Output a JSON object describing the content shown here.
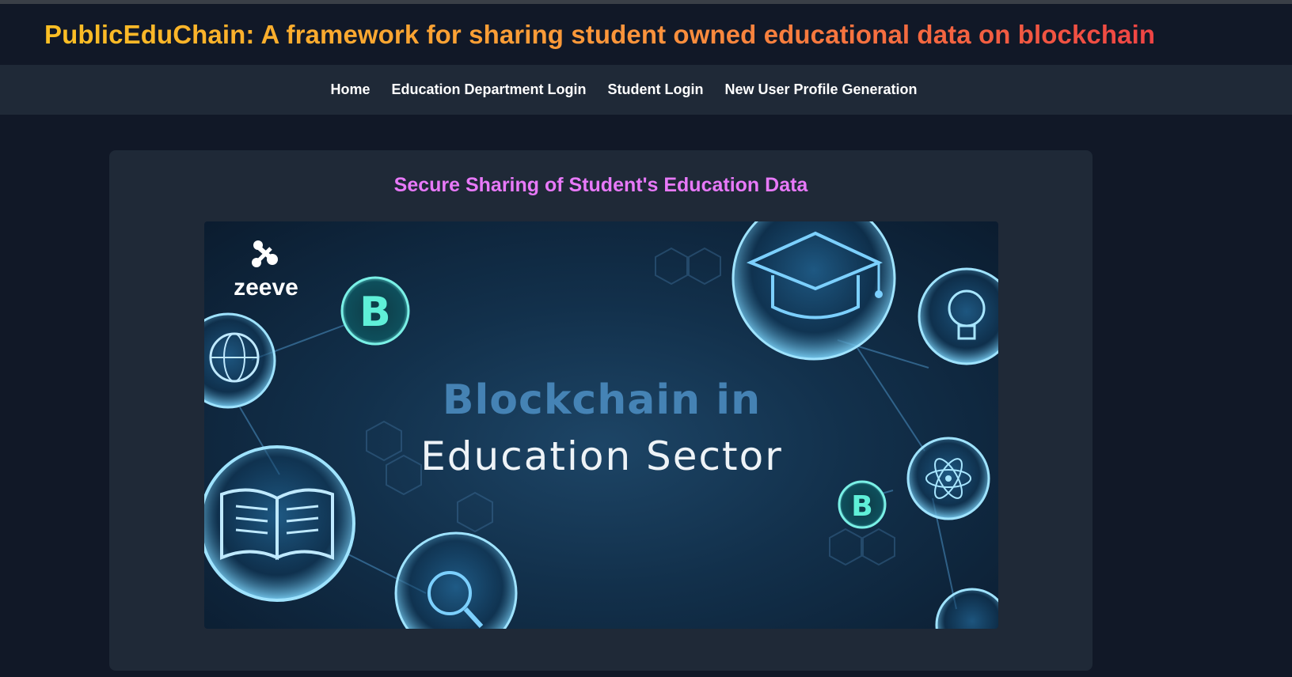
{
  "header": {
    "title": "PublicEduChain: A framework for sharing student owned educational data on blockchain"
  },
  "nav": {
    "items": [
      {
        "label": "Home"
      },
      {
        "label": "Education Department Login"
      },
      {
        "label": "Student Login"
      },
      {
        "label": "New User Profile Generation"
      }
    ]
  },
  "main": {
    "card_title": "Secure Sharing of Student's Education Data",
    "hero": {
      "logo_text": "zeeve",
      "headline_line1": "Blockchain in",
      "headline_line2": "Education Sector",
      "coin_symbol": "B",
      "icons": [
        "zeeve-logo-icon",
        "bitcoin-icon",
        "globe-icon",
        "graduation-cap-icon",
        "lightbulb-icon",
        "open-book-icon",
        "magnifier-icon",
        "atom-icon"
      ]
    }
  },
  "colors": {
    "page_bg": "#111827",
    "nav_bg": "#1f2937",
    "card_bg": "#1f2937",
    "title_gradient_start": "#fbbf24",
    "title_gradient_end": "#ef4444",
    "card_title": "#e879f9",
    "nav_text": "#ffffff"
  }
}
